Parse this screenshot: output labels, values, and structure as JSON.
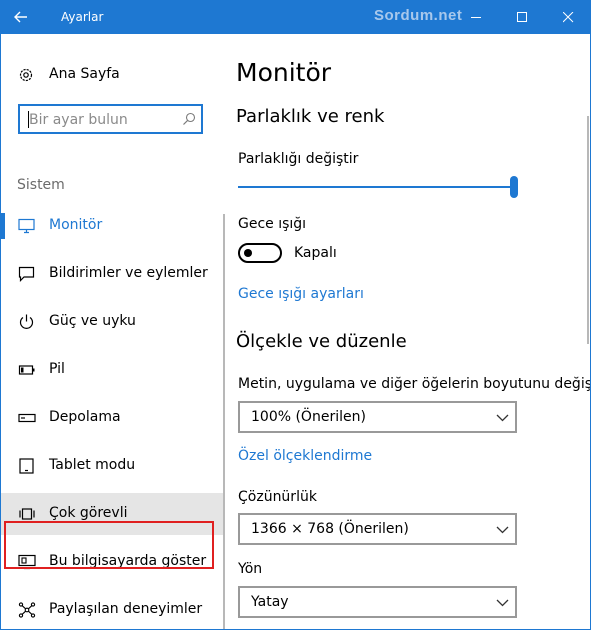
{
  "window": {
    "title": "Ayarlar",
    "watermark": "Sordum.net",
    "accent_color": "#1e78d2",
    "controls": [
      "back-arrow-icon",
      "minimize-icon",
      "maximize-icon",
      "close-icon"
    ]
  },
  "nav": {
    "home": {
      "label": "Ana Sayfa",
      "icon": "gear-icon"
    },
    "search": {
      "placeholder": "Bir ayar bulun",
      "icon": "search-icon"
    },
    "section": "Sistem",
    "items": [
      {
        "label": "Monitör",
        "icon": "monitor-icon",
        "active": true
      },
      {
        "label": "Bildirimler ve eylemler",
        "icon": "notifications-icon"
      },
      {
        "label": "Güç ve uyku",
        "icon": "power-icon"
      },
      {
        "label": "Pil",
        "icon": "battery-icon"
      },
      {
        "label": "Depolama",
        "icon": "storage-icon"
      },
      {
        "label": "Tablet modu",
        "icon": "tablet-icon"
      },
      {
        "label": "Çok görevli",
        "icon": "multitasking-icon",
        "highlighted": true
      },
      {
        "label": "Bu bilgisayarda göster",
        "icon": "project-icon"
      },
      {
        "label": "Paylaşılan deneyimler",
        "icon": "shared-icon"
      }
    ]
  },
  "main": {
    "title": "Monitör",
    "brightness_section": {
      "heading": "Parlaklık ve renk",
      "slider_label": "Parlaklığı değiştir",
      "brightness_percent": 100,
      "night_light_label": "Gece ışığı",
      "night_light_state": "Kapalı",
      "night_light_link": "Gece ışığı ayarları"
    },
    "scale_section": {
      "heading": "Ölçekle ve düzenle",
      "scale_label": "Metin, uygulama ve diğer öğelerin boyutunu değiştir",
      "scale_value": "100% (Önerilen)",
      "custom_scaling_link": "Özel ölçeklendirme",
      "resolution_label": "Çözünürlük",
      "resolution_value": "1366 × 768 (Önerilen)",
      "orientation_label": "Yön",
      "orientation_value": "Yatay"
    }
  }
}
